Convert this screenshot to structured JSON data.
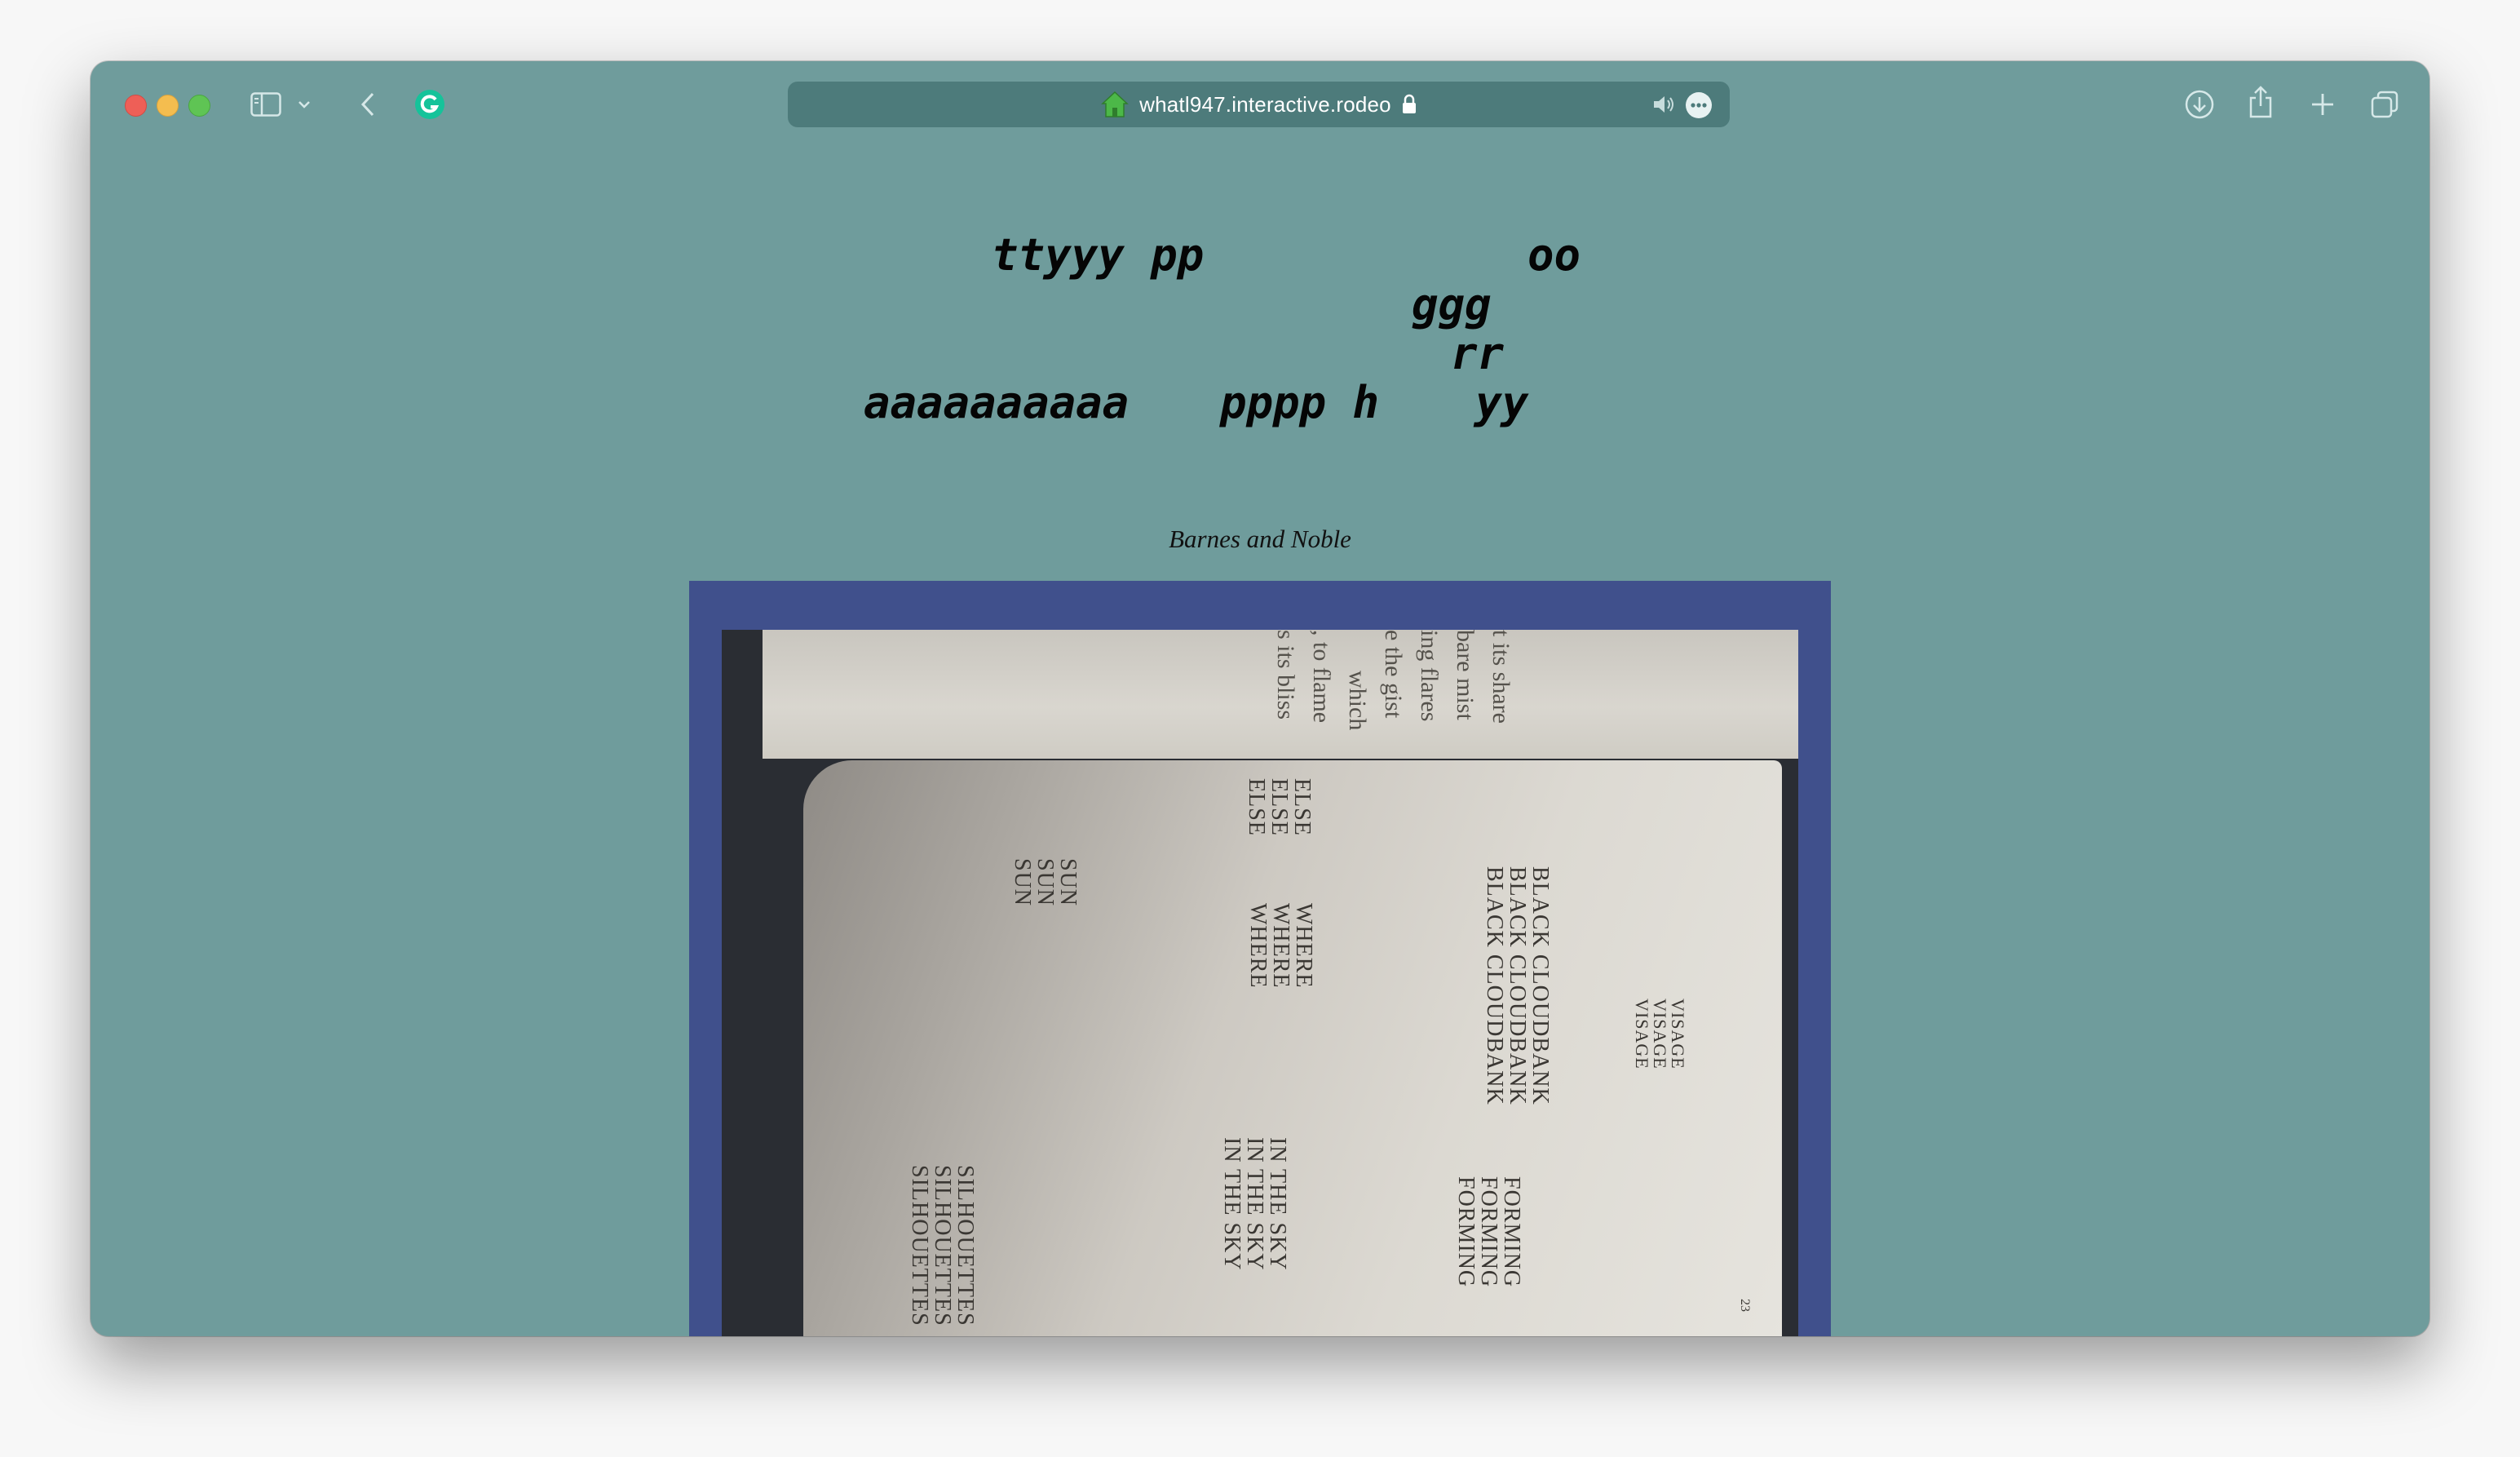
{
  "browser": {
    "url": "whatl947.interactive.rodeo",
    "icons": [
      "sidebar-icon",
      "chevron-down-icon",
      "back-arrow-icon",
      "grammarly-icon",
      "home-icon",
      "lock-icon",
      "speaker-icon",
      "more-icon",
      "download-icon",
      "share-icon",
      "plus-icon",
      "tabs-icon"
    ]
  },
  "poem": {
    "line1a": "ttyyy pp",
    "line1b": "oo",
    "line2": "ggg",
    "line3": "rr",
    "line4a": "aaaaaaaaaa",
    "line4b": "pppp h",
    "line4c": "yy"
  },
  "caption": "Barnes and Noble",
  "book": {
    "top_page_lines": [
      "t its share",
      "bare mist",
      "ing flares",
      "e the gist",
      "which",
      ", to flame",
      "s its bliss"
    ],
    "words": {
      "else": "ELSE\nELSE\nELSE",
      "sun": "SUN\nSUN\nSUN",
      "where": "WHERE\nWHERE\nWHERE",
      "black_cloudbank": "BLACK CLOUDBANK\nBLACK CLOUDBANK\nBLACK CLOUDBANK",
      "visage": "VISAGE\nVISAGE\nVISAGE",
      "in_the_sky": "IN THE SKY\nIN THE SKY\nIN THE SKY",
      "forming": "FORMING\nFORMING\nFORMING",
      "silhouettes": "SILHOUETTES\nSILHOUETTES\nSILHOUETTES",
      "page_number": "23"
    }
  }
}
